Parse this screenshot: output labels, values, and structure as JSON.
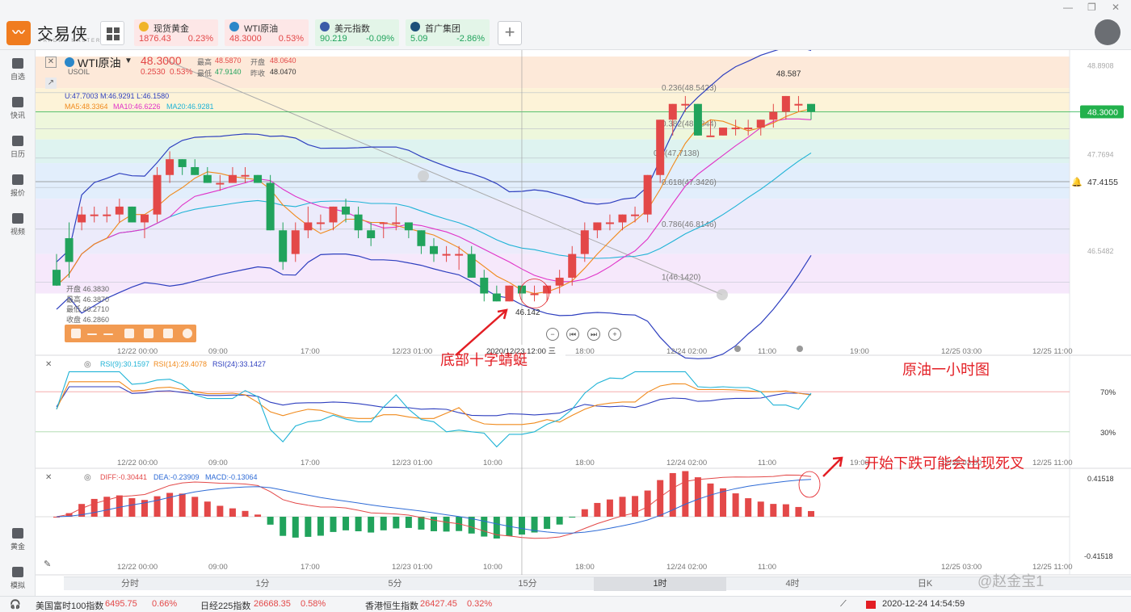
{
  "app": {
    "name": "交易侠",
    "subname": "TRADER MASTER"
  },
  "quotes": [
    {
      "name": "现货黄金",
      "price": "1876.43",
      "pct": "0.23%",
      "dir": "up",
      "icon": "gold-icon",
      "bg": "#fde7e7"
    },
    {
      "name": "WTI原油",
      "price": "48.3000",
      "pct": "0.53%",
      "dir": "up",
      "icon": "oil-icon",
      "bg": "#fde7e7"
    },
    {
      "name": "美元指数",
      "price": "90.219",
      "pct": "-0.09%",
      "dir": "down",
      "icon": "us-flag-icon",
      "bg": "#e3f5e8"
    },
    {
      "name": "首广集团",
      "price": "5.09",
      "pct": "-2.86%",
      "dir": "down",
      "icon": "stock-icon",
      "bg": "#e3f5e8"
    }
  ],
  "sidebar": [
    {
      "label": "自选",
      "icon": "add-watchlist-icon"
    },
    {
      "label": "快讯",
      "icon": "news-icon"
    },
    {
      "label": "日历",
      "icon": "calendar-icon"
    },
    {
      "label": "报价",
      "icon": "quote-chart-icon"
    },
    {
      "label": "视频",
      "icon": "video-icon"
    },
    {
      "label": "黄金",
      "icon": "gold-table-icon"
    },
    {
      "label": "模拟",
      "icon": "simulate-icon"
    }
  ],
  "symbol": {
    "name": "WTI原油",
    "code": "USOIL",
    "price": "48.3000",
    "change": "0.2530",
    "pct": "0.53%",
    "high_label": "最高",
    "high": "48.5870",
    "open_label": "开盘",
    "open": "48.0640",
    "low_label": "最低",
    "low": "47.9140",
    "prev_label": "昨收",
    "prev": "48.0470"
  },
  "indicators": {
    "boll": "U:47.7003  M:46.9291  L:46.1580",
    "ma": [
      "MA5:48.3364",
      "MA10:46.6226",
      "MA20:46.9281"
    ],
    "rsi": [
      "RSI(9):30.1597",
      "RSI(14):29.4078",
      "RSI(24):33.1427"
    ],
    "macd": [
      "DIFF:-0.30441",
      "DEA:-0.23909",
      "MACD:-0.13064"
    ]
  },
  "ohlc_box": [
    "开盘 46.3830",
    "最高 46.3870",
    "最低 46.2710",
    "收盘 46.2860"
  ],
  "price_axis": [
    "48.8908",
    "48.3000",
    "47.7694",
    "47.4155",
    "46.5482"
  ],
  "rsi_axis": [
    "70%",
    "30%"
  ],
  "macd_axis": [
    "0.41518",
    "-0.41518"
  ],
  "fib": [
    "0.236(48.5423)",
    "0.382(48.0844)",
    "0.5(47.7138)",
    "0.618(47.3426)",
    "0.786(46.8146)",
    "1(46.1420)"
  ],
  "time_labels": [
    "12/22 00:00",
    "09:00",
    "17:00",
    "12/23 01:00",
    "10:00",
    "18:00",
    "12/24 02:00",
    "11:00",
    "19:00",
    "12/25 03:00",
    "12/25 11:00"
  ],
  "crosshair_time": "2020/12/23 12:00 三",
  "price_marks": {
    "low": "46.142",
    "high": "48.587"
  },
  "annotations": {
    "bottom": "底部十字蜻蜓",
    "title": "原油一小时图",
    "cross": "开始下跌可能会出现死叉"
  },
  "tabs": [
    "分时",
    "1分",
    "5分",
    "15分",
    "1时",
    "4时",
    "日K"
  ],
  "active_tab": "1时",
  "status": {
    "items": [
      {
        "name": "美国富时100指数",
        "value": "6495.75",
        "pct": "0.66%"
      },
      {
        "name": "日经225指数",
        "value": "26668.35",
        "pct": "0.58%"
      },
      {
        "name": "香港恒生指数",
        "value": "26427.45",
        "pct": "0.32%"
      }
    ],
    "datetime": "2020-12-24 14:54:59"
  },
  "watermark": "@赵金宝1",
  "colors": {
    "up": "#e34848",
    "down": "#21a35c",
    "accent": "#f07c1f"
  },
  "chart_data": {
    "type": "candlestick",
    "candles": [
      [
        46.3,
        46.5,
        46.1,
        46.1
      ],
      [
        46.7,
        46.9,
        46.2,
        46.4
      ],
      [
        46.9,
        47.1,
        46.8,
        47.0
      ],
      [
        47.0,
        47.1,
        46.9,
        47.0
      ],
      [
        47.0,
        47.1,
        46.9,
        47.0
      ],
      [
        47.0,
        47.2,
        46.9,
        47.1
      ],
      [
        47.1,
        47.1,
        46.9,
        46.9
      ],
      [
        46.9,
        47.0,
        46.7,
        47.0
      ],
      [
        47.0,
        47.6,
        46.9,
        47.5
      ],
      [
        47.5,
        47.8,
        47.4,
        47.7
      ],
      [
        47.7,
        47.7,
        47.5,
        47.6
      ],
      [
        47.6,
        47.7,
        47.5,
        47.5
      ],
      [
        47.5,
        47.6,
        47.4,
        47.4
      ],
      [
        47.4,
        47.5,
        47.3,
        47.4
      ],
      [
        47.4,
        47.6,
        47.4,
        47.5
      ],
      [
        47.5,
        47.6,
        47.4,
        47.5
      ],
      [
        47.5,
        47.5,
        47.4,
        47.4
      ],
      [
        47.4,
        47.5,
        46.8,
        46.8
      ],
      [
        46.8,
        46.9,
        46.3,
        46.4
      ],
      [
        46.5,
        46.9,
        46.4,
        46.8
      ],
      [
        46.8,
        47.1,
        46.7,
        46.9
      ],
      [
        46.9,
        47.0,
        46.8,
        46.9
      ],
      [
        46.9,
        47.1,
        46.8,
        47.1
      ],
      [
        47.1,
        47.2,
        46.9,
        47.0
      ],
      [
        47.0,
        47.1,
        46.7,
        46.8
      ],
      [
        46.8,
        46.9,
        46.6,
        46.7
      ],
      [
        46.9,
        46.9,
        46.7,
        46.9
      ],
      [
        46.9,
        47.1,
        46.8,
        46.9
      ],
      [
        46.9,
        46.9,
        46.7,
        46.8
      ],
      [
        46.8,
        46.8,
        46.5,
        46.6
      ],
      [
        46.6,
        46.7,
        46.4,
        46.5
      ],
      [
        46.5,
        46.6,
        46.4,
        46.5
      ],
      [
        46.5,
        46.6,
        46.3,
        46.5
      ],
      [
        46.5,
        46.6,
        46.2,
        46.2
      ],
      [
        46.2,
        46.3,
        45.9,
        46.0
      ],
      [
        46.0,
        46.1,
        45.9,
        45.9
      ],
      [
        45.9,
        46.1,
        45.9,
        46.1
      ],
      [
        46.1,
        46.1,
        45.9,
        46.0
      ],
      [
        46.0,
        46.1,
        45.9,
        46.0
      ],
      [
        46.0,
        46.1,
        45.9,
        46.1
      ],
      [
        46.1,
        46.3,
        46.0,
        46.2
      ],
      [
        46.2,
        46.6,
        46.1,
        46.5
      ],
      [
        46.5,
        46.9,
        46.4,
        46.8
      ],
      [
        46.8,
        46.9,
        46.7,
        46.9
      ],
      [
        46.9,
        47.0,
        46.8,
        46.9
      ],
      [
        46.9,
        47.0,
        46.8,
        47.0
      ],
      [
        47.0,
        47.1,
        46.9,
        47.0
      ],
      [
        47.0,
        47.5,
        46.9,
        47.5
      ],
      [
        47.5,
        48.2,
        47.4,
        48.2
      ],
      [
        48.2,
        48.4,
        48.0,
        48.4
      ],
      [
        48.4,
        48.5,
        48.3,
        48.4
      ],
      [
        48.4,
        48.4,
        48.0,
        48.0
      ],
      [
        48.0,
        48.2,
        48.0,
        48.0
      ],
      [
        48.0,
        48.1,
        48.0,
        48.1
      ],
      [
        48.1,
        48.2,
        48.0,
        48.1
      ],
      [
        48.1,
        48.2,
        48.0,
        48.1
      ],
      [
        48.1,
        48.2,
        48.0,
        48.2
      ],
      [
        48.2,
        48.4,
        48.1,
        48.3
      ],
      [
        48.3,
        48.5,
        48.2,
        48.5
      ],
      [
        48.4,
        48.5,
        48.3,
        48.4
      ],
      [
        48.4,
        48.4,
        48.2,
        48.3
      ]
    ]
  }
}
